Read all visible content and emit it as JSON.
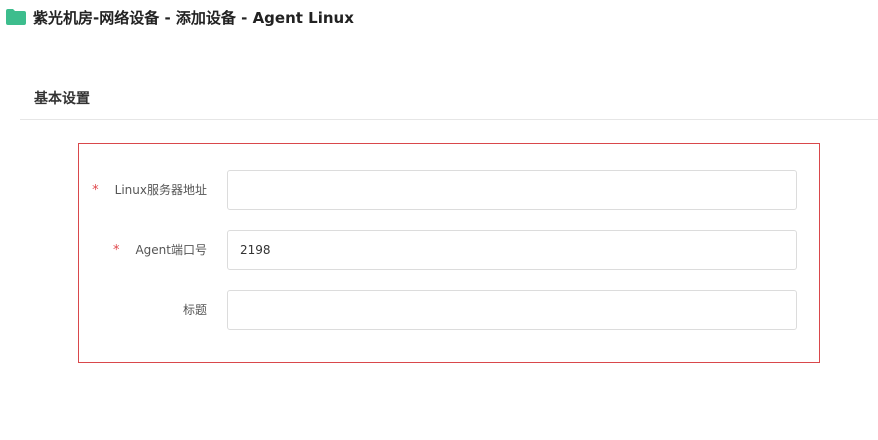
{
  "header": {
    "title": "紫光机房-网络设备 - 添加设备 - Agent Linux",
    "icon": "folder-icon",
    "icon_color": "#3dbd8d"
  },
  "section": {
    "title": "基本设置"
  },
  "form": {
    "border_color": "#d9484b",
    "fields": [
      {
        "label": "Linux服务器地址",
        "required": true,
        "required_mark": "*",
        "value": ""
      },
      {
        "label": "Agent端口号",
        "required": true,
        "required_mark": "*",
        "value": "2198"
      },
      {
        "label": "标题",
        "required": false,
        "required_mark": "",
        "value": ""
      }
    ]
  }
}
